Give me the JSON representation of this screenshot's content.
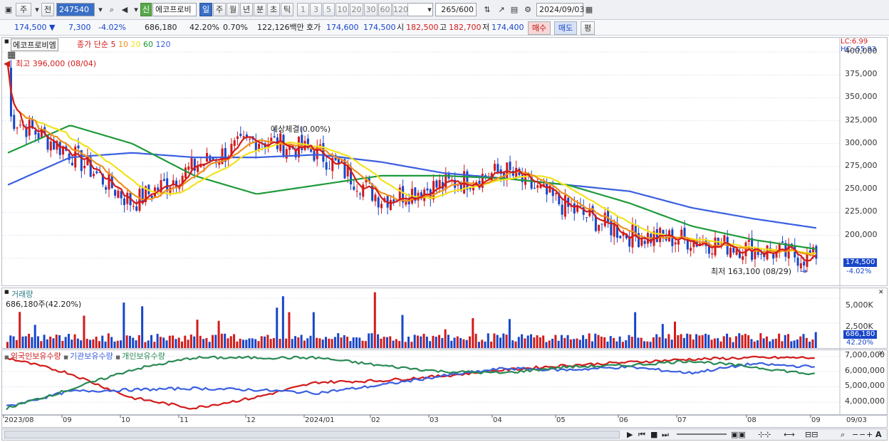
{
  "toolbar": {
    "period_label": "주",
    "prev_label": "전",
    "code_value": "247540",
    "stock_badge": "신",
    "stock_name": "에코프로비",
    "periods": [
      "일",
      "주",
      "월",
      "년",
      "분",
      "초",
      "틱"
    ],
    "active_period": "일",
    "minutes": [
      "1",
      "3",
      "5",
      "10",
      "20",
      "30",
      "60",
      "120"
    ],
    "count_value": "265",
    "count_total": "/600",
    "date_value": "2024/09/03"
  },
  "quote": {
    "price": "174,500",
    "change": "7,300",
    "change_pct": "-4.02%",
    "volume": "686,180",
    "vol_ratio": "42.20%",
    "turnover": "0.70%",
    "amount": "122,126백만",
    "ask_label": "호가",
    "ask": "174,600",
    "bid": "174,500",
    "open_label": "시",
    "open": "182,500",
    "high_label": "고",
    "high": "182,700",
    "low_label": "저",
    "low": "174,400",
    "buy_label": "매수",
    "sell_label": "매도",
    "extra_label": "평"
  },
  "price_pane": {
    "name": "에코프로비엠",
    "legend": [
      "종가",
      "단순",
      "5",
      "10",
      "20",
      "60",
      "120"
    ],
    "max_label": "최고 396,000 (08/04)",
    "min_label": "최저 163,100 (08/29)",
    "mid_label": "예상체결(0.00%)",
    "lc": "LC:6.99",
    "hc": "HC:-55.93",
    "price_box": "174,500",
    "pct_box": "-4.02%",
    "y_ticks": [
      "400,000",
      "375,000",
      "350,000",
      "325,000",
      "300,000",
      "275,000",
      "250,000",
      "225,000",
      "200,000"
    ]
  },
  "volume_pane": {
    "title": "거래량",
    "value": "686,180주(42.20%)",
    "ticks": [
      "5,000K",
      "2,500K"
    ],
    "box": "686,180",
    "pct": "42.20%"
  },
  "holdings_pane": {
    "legend": [
      "외국인보유수량",
      "기관보유수량",
      "개인보유수량"
    ],
    "ticks": [
      "7,000,000",
      "6,000,000",
      "5,000,000",
      "4,000,000"
    ]
  },
  "x_axis": [
    "2023/08",
    "09",
    "10",
    "11",
    "12",
    "2024/01",
    "02",
    "03",
    "04",
    "05",
    "06",
    "07",
    "08",
    "09",
    "09/03"
  ],
  "colors": {
    "up": "#d21b1b",
    "down": "#1846c8",
    "ma5": "#d21b1b",
    "ma10": "#f0901a",
    "ma20": "#f2e21c",
    "ma60": "#1f9a3a",
    "ma120": "#3a5fe0",
    "foreign": "#d21b1b",
    "institution": "#3a5fe0",
    "individual": "#2a8a55"
  },
  "chart_data": {
    "type": "candlestick",
    "title": "에코프로비엠",
    "x": [
      "2023-08",
      "2023-09",
      "2023-10",
      "2023-11",
      "2023-12",
      "2024-01",
      "2024-02",
      "2024-03",
      "2024-04",
      "2024-05",
      "2024-06",
      "2024-07",
      "2024-08",
      "2024-09-03"
    ],
    "close": [
      330000,
      290000,
      235000,
      275000,
      305000,
      290000,
      240000,
      255000,
      270000,
      230000,
      200000,
      195000,
      185000,
      174500
    ],
    "ma60": [
      290000,
      320000,
      300000,
      265000,
      245000,
      255000,
      265000,
      265000,
      262000,
      255000,
      235000,
      210000,
      195000,
      185000
    ],
    "ma120": [
      255000,
      285000,
      290000,
      285000,
      285000,
      288000,
      280000,
      268000,
      262000,
      255000,
      248000,
      230000,
      218000,
      208000
    ],
    "ylim": [
      150000,
      400000
    ],
    "volume_ylim": [
      0,
      6000
    ],
    "series": [
      {
        "name": "외국인보유수량",
        "values": [
          6900000,
          5900000,
          4300000,
          3600000,
          4300000,
          5300000,
          5400000,
          5700000,
          6100000,
          6400000,
          6600000,
          6800000,
          6900000,
          6900000
        ]
      },
      {
        "name": "기관보유수량",
        "values": [
          3700000,
          4700000,
          4800000,
          4900000,
          4800000,
          4600000,
          5100000,
          5700000,
          6200000,
          6100000,
          6300000,
          5900000,
          6500000,
          6300000
        ]
      },
      {
        "name": "개인보유수량",
        "values": [
          3600000,
          4800000,
          6100000,
          6900000,
          6900000,
          6900000,
          6400000,
          6000000,
          5900000,
          6300000,
          6400000,
          6700000,
          6300000,
          5800000
        ]
      }
    ]
  }
}
